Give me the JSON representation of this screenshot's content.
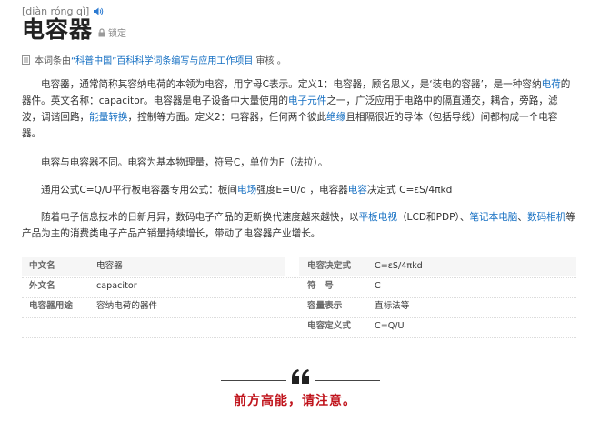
{
  "header": {
    "pinyin": "[diàn róng qì]",
    "title": "电容器",
    "lock_label": "锁定"
  },
  "source_note": {
    "prefix": "本词条由",
    "link": "“科普中国”百科科学词条编写与应用工作项目",
    "suffix": " 审核 。"
  },
  "paragraphs": {
    "p1": [
      {
        "t": "电容器，通常简称其容纳电荷的本领为电容，用字母C表示。定义1：电容器，顾名思义，是‘装电的容器’，是一种容纳"
      },
      {
        "t": "电荷",
        "link": true
      },
      {
        "t": "的器件。英文名称：capacitor。电容器是电子设备中大量使用的"
      },
      {
        "t": "电子元件",
        "link": true
      },
      {
        "t": "之一，广泛应用于电路中的隔直通交，耦合，旁路，滤波，调谐回路，"
      },
      {
        "t": "能量转换",
        "link": true
      },
      {
        "t": "，控制等方面。定义2：电容器，任何两个彼此"
      },
      {
        "t": "绝缘",
        "link": true
      },
      {
        "t": "且相隔很近的导体（包括导线）间都构成一个电容器。"
      }
    ],
    "p2": [
      {
        "t": "电容与电容器不同。电容为基本物理量，符号C，单位为F（法拉）。"
      }
    ],
    "p3": [
      {
        "t": "通用公式C=Q/U平行板电容器专用公式：板间"
      },
      {
        "t": "电场",
        "link": true
      },
      {
        "t": "强度E=U/d ，电容器"
      },
      {
        "t": "电容",
        "link": true
      },
      {
        "t": "决定式 C=εS/4πkd"
      }
    ],
    "p4": [
      {
        "t": "随着电子信息技术的日新月异，数码电子产品的更新换代速度越来越快，以"
      },
      {
        "t": "平板电视",
        "link": true
      },
      {
        "t": "（LCD和PDP）、"
      },
      {
        "t": "笔记本电脑",
        "link": true
      },
      {
        "t": "、"
      },
      {
        "t": "数码相机",
        "link": true
      },
      {
        "t": "等产品为主的消费类电子产品产销量持续增长，带动了电容器产业增长。"
      }
    ]
  },
  "infobox": {
    "rows": [
      {
        "left_key": "中文名",
        "left_val": "电容器",
        "right_key": "电容决定式",
        "right_val": "C=εS/4πkd"
      },
      {
        "left_key": "外文名",
        "left_val": "capacitor",
        "right_key": "符　号",
        "right_val": "C"
      },
      {
        "left_key": "电容器用途",
        "left_val": "容纳电荷的器件",
        "right_key": "容量表示",
        "right_val": "直标法等"
      },
      {
        "left_key": "",
        "left_val": "",
        "right_key": "电容定义式",
        "right_val": "C=Q/U"
      }
    ]
  },
  "footer": {
    "warning": "前方高能，请注意。"
  },
  "colors": {
    "link": "#136ec2",
    "warning": "#c0141c"
  }
}
